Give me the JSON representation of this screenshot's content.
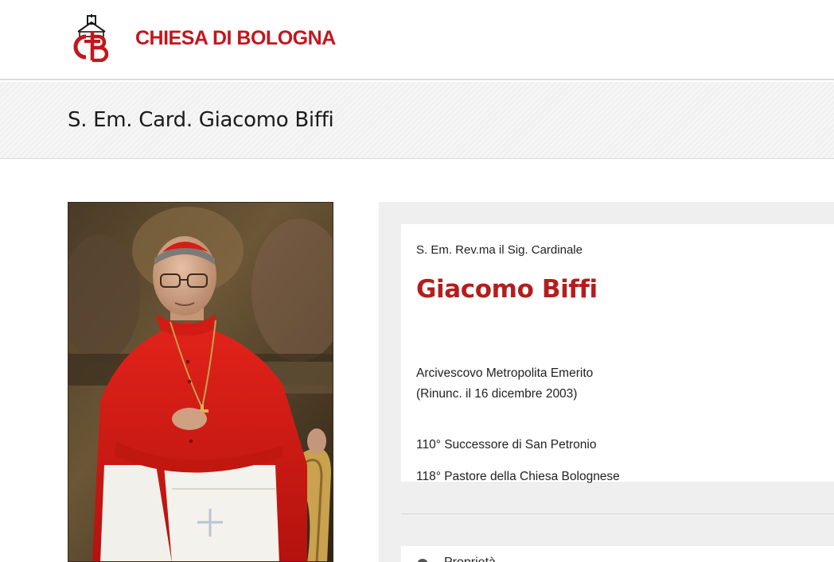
{
  "header": {
    "site_name": "CHIESA DI BOLOGNA",
    "logo_icon": "chiesa-di-bologna-logo",
    "brand_color": "#c3161c"
  },
  "title_band": {
    "title": "S. Em. Card. Giacomo Biffi"
  },
  "portrait": {
    "alt": "Portrait of Cardinal Giacomo Biffi"
  },
  "profile": {
    "prefix": "S. Em. Rev.ma il Sig. Cardinale",
    "name": "Giacomo Biffi",
    "name_color": "#b51d1d",
    "role_line1": "Arcivescovo Metropolita Emerito",
    "role_line2": "(Rinunc. il 16 dicembre 2003)",
    "successor": "110° Successore di San Petronio",
    "pastor": "118° Pastore della Chiesa Bolognese"
  },
  "next_card": {
    "label": "Proprietà"
  }
}
